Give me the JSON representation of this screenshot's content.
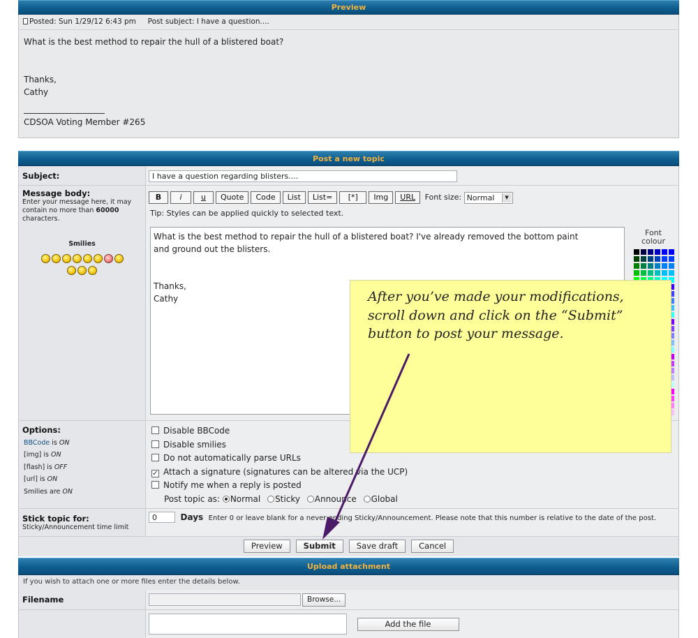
{
  "preview": {
    "header": "Preview",
    "posted_label": "Posted: Sun 1/29/12 6:43 pm",
    "subject_label": "Post subject: I have a question....",
    "body_line1": "What is the best method to repair the hull of a blistered boat?",
    "body_line2": "Thanks,",
    "body_line3": "Cathy",
    "signature": "CDSOA Voting Member #265"
  },
  "post_topic": {
    "header": "Post a new topic",
    "subject_label": "Subject:",
    "subject_value": "I have a question regarding blisters....",
    "message_label": "Message body:",
    "message_hint_a": "Enter your message here, it may contain no more than ",
    "message_hint_num": "60000",
    "message_hint_b": " characters.",
    "smilies_label": "Smilies",
    "toolbar": {
      "bold": "B",
      "italic": "i",
      "underline": "u",
      "quote": "Quote",
      "code": "Code",
      "list": "List",
      "list_eq": "List=",
      "star": "[*]",
      "img": "Img",
      "url": "URL",
      "font_size_label": "Font size:",
      "font_size_value": "Normal"
    },
    "tip": "Tip: Styles can be applied quickly to selected text.",
    "font_colour_label_1": "Font",
    "font_colour_label_2": "colour",
    "message_line1": "What is the best method to repair the hull of a blistered boat?  I've already removed the bottom paint",
    "message_line2": "and ground out the blisters.",
    "message_line3": "Thanks,",
    "message_line4": "Cathy",
    "options": {
      "label": "Options:",
      "bbcode_link": "BBCode",
      "bbcode_is": " is ",
      "on": "ON",
      "off": "OFF",
      "img_label": "[img] is ",
      "flash_label": "[flash] is ",
      "url_label": "[url] is ",
      "smilies_label": "Smilies are ",
      "disable_bbcode": "Disable BBCode",
      "disable_smilies": "Disable smilies",
      "no_parse_urls": "Do not automatically parse URLs",
      "attach_signature": "Attach a signature (signatures can be altered via the UCP)",
      "notify": "Notify me when a reply is posted",
      "post_topic_as": "Post topic as:",
      "normal": "Normal",
      "sticky": "Sticky",
      "announce": "Announce",
      "global": "Global"
    },
    "stick": {
      "label": "Stick topic for:",
      "sublabel": "Sticky/Announcement time limit",
      "value": "0",
      "days": "Days",
      "note": "Enter 0 or leave blank for a never ending Sticky/Announcement. Please note that this number is relative to the date of the post."
    },
    "buttons": {
      "preview": "Preview",
      "submit": "Submit",
      "save_draft": "Save draft",
      "cancel": "Cancel"
    }
  },
  "upload": {
    "header": "Upload attachment",
    "info": "If you wish to attach one or more files enter the details below.",
    "filename_label": "Filename",
    "browse": "Browse...",
    "add_file": "Add the file"
  },
  "callout": {
    "line1": "After you’ve made your modifications,",
    "line2": "scroll down and click on the “Submit”",
    "line3": "button to post your message."
  },
  "colors": {
    "header_text": "#f3b33d",
    "callout_bg": "#ffff99",
    "arrow": "#4b1a66"
  }
}
